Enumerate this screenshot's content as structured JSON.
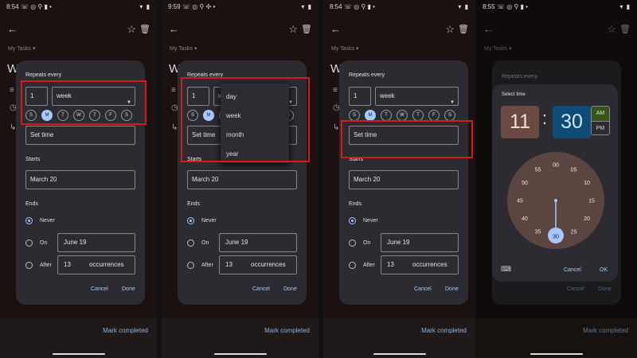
{
  "panels": [
    {
      "status_time": "8:54",
      "status_left_icons": "☏ ◎ ⚲ ▮ •",
      "status_right_icons": "▾ ▮",
      "my_tasks": "My Tasks",
      "bg_title": "W",
      "repeats_every": "Repeats every",
      "interval": "1",
      "unit": "week",
      "days": [
        "S",
        "M",
        "T",
        "W",
        "T",
        "F",
        "S"
      ],
      "selected_day_index": 1,
      "set_time": "Set time",
      "starts": "Starts",
      "start_date": "March 20",
      "ends": "Ends",
      "never": "Never",
      "on": "On",
      "on_date": "June 19",
      "after": "After",
      "occ_count": "13",
      "occurrences": "occurrences",
      "cancel": "Cancel",
      "done": "Done",
      "mark_completed": "Mark completed"
    },
    {
      "status_time": "9:59",
      "status_left_icons": "☏ ◎ ⚲ ✣ •",
      "status_right_icons": "▾ ▮",
      "my_tasks": "My Tasks",
      "bg_title": "W",
      "repeats_every": "Repeats every",
      "interval": "1",
      "unit": "week",
      "days": [
        "S",
        "M",
        "T",
        "W",
        "T",
        "F",
        "S"
      ],
      "selected_day_index": 1,
      "set_time": "Set time",
      "starts": "Starts",
      "start_date": "March 20",
      "ends": "Ends",
      "never": "Never",
      "on": "On",
      "on_date": "June 19",
      "after": "After",
      "occ_count": "13",
      "occurrences": "occurrences",
      "cancel": "Cancel",
      "done": "Done",
      "mark_completed": "Mark completed",
      "menu_options": [
        "day",
        "week",
        "month",
        "year"
      ]
    },
    {
      "status_time": "8:54",
      "status_left_icons": "☏ ◎ ⚲ ▮ •",
      "status_right_icons": "▾ ▮",
      "my_tasks": "My Tasks",
      "bg_title": "W",
      "repeats_every": "Repeats every",
      "interval": "1",
      "unit": "week",
      "days": [
        "S",
        "M",
        "T",
        "W",
        "T",
        "F",
        "S"
      ],
      "selected_day_index": 1,
      "set_time": "Set time",
      "starts": "Starts",
      "start_date": "March 20",
      "ends": "Ends",
      "never": "Never",
      "on": "On",
      "on_date": "June 19",
      "after": "After",
      "occ_count": "13",
      "occurrences": "occurrences",
      "cancel": "Cancel",
      "done": "Done",
      "mark_completed": "Mark completed"
    },
    {
      "status_time": "8:55",
      "status_left_icons": "☏ ◎ ⚲ ▮ •",
      "status_right_icons": "▾ ▮",
      "my_tasks": "My Tasks",
      "repeats_every": "Repeats every",
      "select_time": "Select time",
      "hour": "11",
      "colon": ":",
      "minute": "30",
      "am": "AM",
      "pm": "PM",
      "clock_numbers": [
        "00",
        "05",
        "10",
        "15",
        "20",
        "25",
        "30",
        "35",
        "40",
        "45",
        "50",
        "55"
      ],
      "selected_minute": "30",
      "cancel": "Cancel",
      "ok": "OK",
      "bg_cancel": "Cancel",
      "bg_done": "Done",
      "mark_completed": "Mark completed",
      "keyboard_icon": "keyboard-icon"
    }
  ],
  "colors": {
    "highlight": "#d21c1c",
    "accent": "#a8c7fa",
    "dialog_bg": "#2c2b31",
    "hour_bg": "#6a4a43",
    "minute_bg": "#0f4b74",
    "am_bg": "#37531d",
    "clock_face": "#5a4540"
  }
}
